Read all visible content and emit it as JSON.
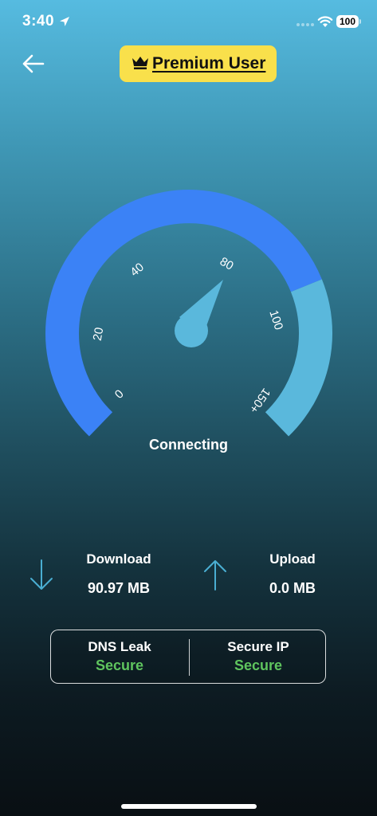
{
  "status_bar": {
    "time": "3:40",
    "battery": "100"
  },
  "header": {
    "premium_label": "Premium User"
  },
  "gauge": {
    "ticks": [
      "0",
      "20",
      "40",
      "80",
      "100",
      "150+"
    ],
    "status": "Connecting",
    "progress_fraction": 0.75,
    "colors": {
      "filled": "#3b82f6",
      "remaining": "#5ab8dc",
      "needle": "#5ab8dc"
    }
  },
  "stats": {
    "download": {
      "label": "Download",
      "value": "90.97 MB"
    },
    "upload": {
      "label": "Upload",
      "value": "0.0 MB"
    }
  },
  "security": {
    "dns": {
      "label": "DNS Leak",
      "value": "Secure"
    },
    "ip": {
      "label": "Secure IP",
      "value": "Secure"
    },
    "ok_color": "#5fc55e"
  },
  "icons": [
    "location-arrow-icon",
    "wifi-icon",
    "back-arrow-icon",
    "crown-icon",
    "download-arrow-icon",
    "upload-arrow-icon"
  ]
}
